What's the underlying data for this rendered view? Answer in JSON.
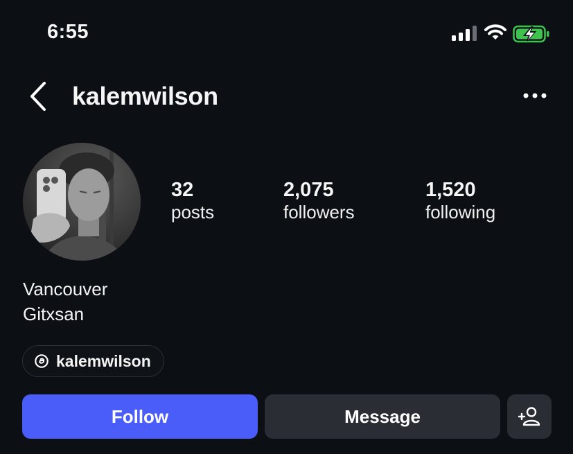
{
  "status_bar": {
    "time": "6:55"
  },
  "header": {
    "username": "kalemwilson"
  },
  "profile": {
    "stats": [
      {
        "value": "32",
        "label": "posts"
      },
      {
        "value": "2,075",
        "label": "followers"
      },
      {
        "value": "1,520",
        "label": "following"
      }
    ],
    "bio_lines": [
      "Vancouver",
      "Gitxsan"
    ],
    "threads_handle": "kalemwilson"
  },
  "actions": {
    "follow_label": "Follow",
    "message_label": "Message"
  },
  "colors": {
    "background": "#0c0f14",
    "follow_button": "#4a5df8",
    "secondary_button": "#2a2d34",
    "battery_green": "#3ec44e"
  },
  "icons": [
    "signal-icon",
    "wifi-icon",
    "battery-charging-icon",
    "back-chevron-icon",
    "more-icon",
    "threads-icon",
    "add-person-icon"
  ]
}
